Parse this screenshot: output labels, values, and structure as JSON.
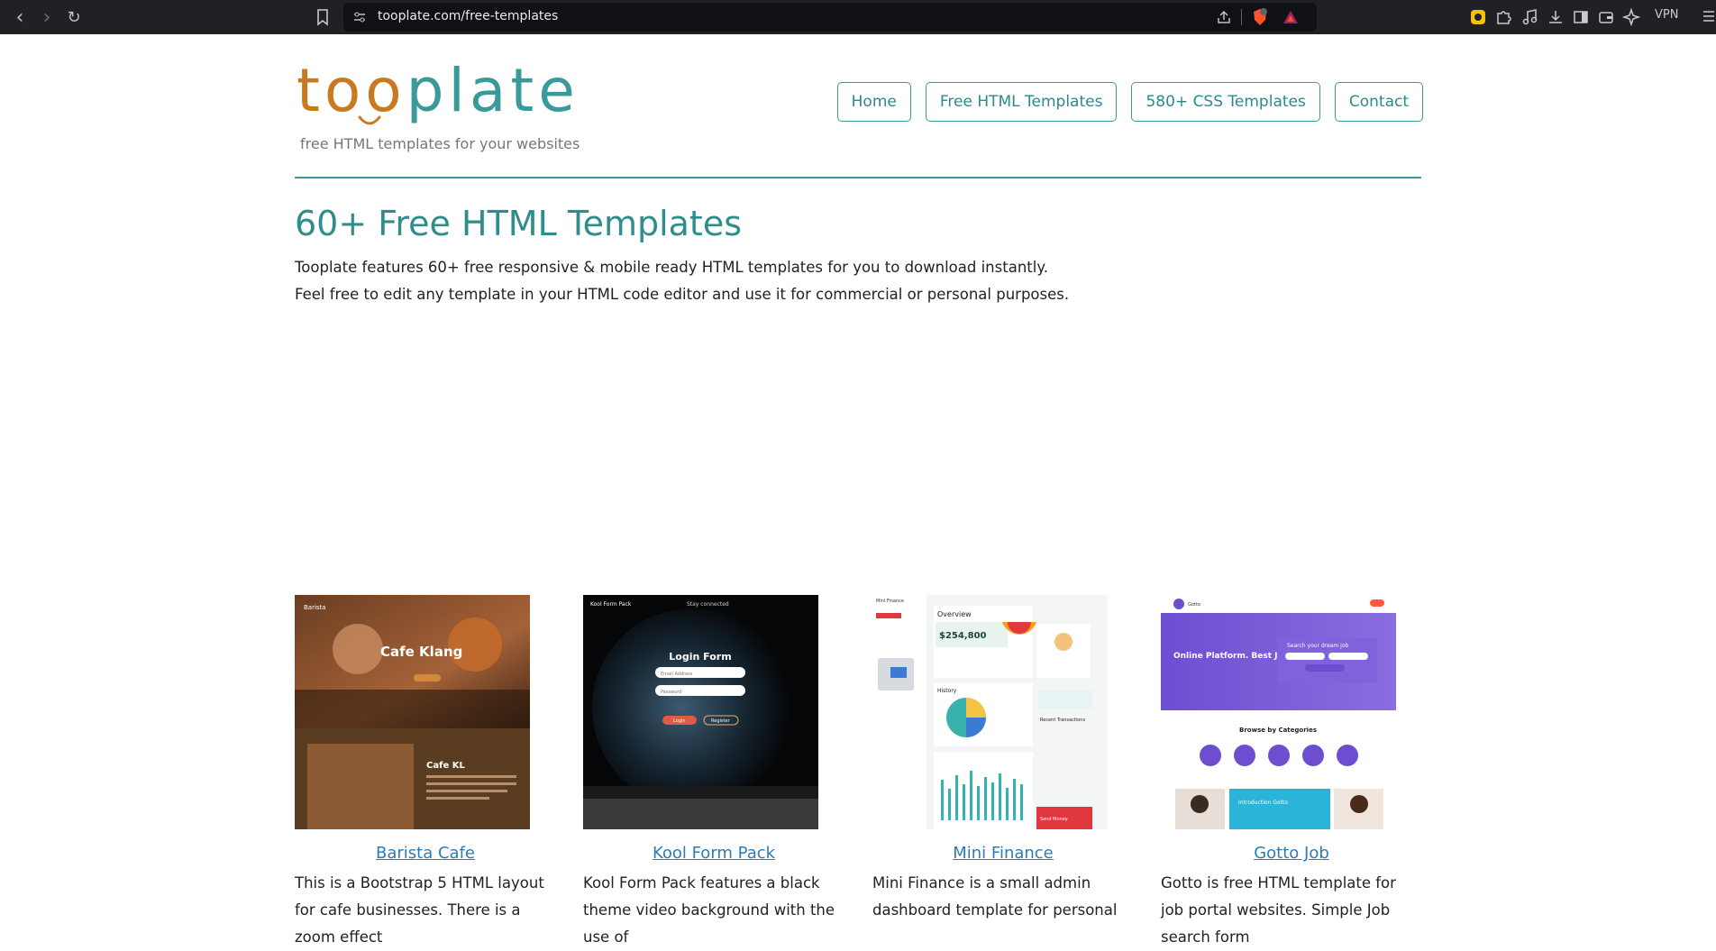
{
  "browser": {
    "url": "tooplate.com/free-templates",
    "vpn_label": "VPN",
    "brave_badge_count": "6"
  },
  "site": {
    "logo_part1": "too",
    "logo_part2": "plate",
    "tagline": "free HTML templates for your websites",
    "nav": [
      "Home",
      "Free HTML Templates",
      "580+ CSS Templates",
      "Contact"
    ]
  },
  "main": {
    "heading": "60+ Free HTML Templates",
    "intro": "Tooplate features 60+ free responsive & mobile ready HTML templates for you to download instantly. Feel free to edit any template in your HTML code editor and use it for commercial or personal purposes."
  },
  "templates": [
    {
      "name": "Barista Cafe",
      "description": "This is a Bootstrap 5 HTML layout for cafe businesses. There is a zoom effect",
      "preview": {
        "brand": "Barista",
        "hero": "Cafe Klang",
        "section": "Cafe KL"
      }
    },
    {
      "name": "Kool Form Pack",
      "description": "Kool Form Pack features a black theme video background with the use of",
      "preview": {
        "brand": "Kool Form Pack",
        "hero": "Login Form",
        "field1": "Email Address",
        "field2": "Password",
        "btn1": "Login",
        "btn2": "Register",
        "top_label": "Stay connected"
      }
    },
    {
      "name": "Mini Finance",
      "description": "Mini Finance is a small admin dashboard template for personal",
      "preview": {
        "brand": "Mini Finance",
        "overview": "Overview",
        "amount": "$254,800",
        "history": "History",
        "recent": "Recent Transactions",
        "send": "Send Money"
      }
    },
    {
      "name": "Gotto Job",
      "description": "Gotto is free HTML template for job portal websites. Simple Job search form",
      "preview": {
        "brand": "Gotto",
        "hero": "Online Platform. Best Job portal",
        "search": "Search your dream job",
        "browse": "Browse by Categories",
        "intro": "Introduction Gotto"
      }
    }
  ],
  "colors": {
    "teal": "#3a9a9a",
    "orange": "#c97a20",
    "link_blue": "#2b7db8"
  }
}
